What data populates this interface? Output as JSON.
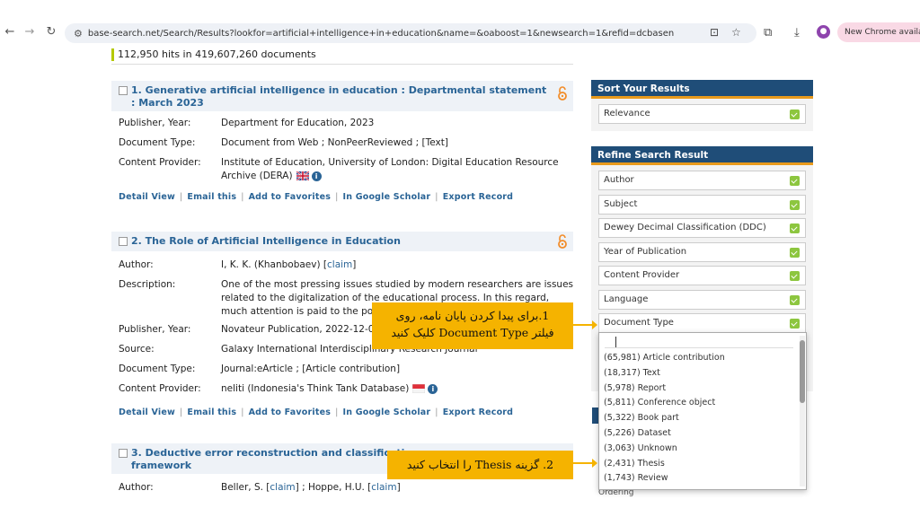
{
  "browser": {
    "url": "base-search.net/Search/Results?lookfor=artificial+intelligence+in+education&name=&oaboost=1&newsearch=1&refid=dcbasen",
    "new_chrome": "New Chrome available"
  },
  "results": {
    "hits": "112,950 hits in 419,607,260 documents",
    "records": [
      {
        "title": "1. Generative artificial intelligence in education : Departmental statement : March 2023",
        "fields": [
          {
            "k": "Publisher, Year:",
            "v": "Department for Education, 2023"
          },
          {
            "k": "Document Type:",
            "v": "Document from Web ; NonPeerReviewed ; [Text]"
          },
          {
            "k": "Content Provider:",
            "v": "Institute of Education, University of London: Digital Education Resource Archive (DERA)"
          }
        ]
      },
      {
        "title": "2. The Role of Artificial Intelligence in Education",
        "fields": [
          {
            "k": "Author:",
            "v": "I, K. K. (Khanbobaev)",
            "claim": "claim"
          },
          {
            "k": "Description:",
            "v": "One of the most pressing issues studied by modern researchers are issues related to the digitalization of the educational process. In this regard, much attention is paid to the pos"
          },
          {
            "k": "Publisher, Year:",
            "v": "Novateur Publication, 2022-12-07"
          },
          {
            "k": "Source:",
            "v": "Galaxy International Interdisciplinary Research Journal"
          },
          {
            "k": "Document Type:",
            "v": "Journal:eArticle ; [Article contribution]"
          },
          {
            "k": "Content Provider:",
            "v": "neliti (Indonesia's Think Tank Database)"
          }
        ]
      },
      {
        "title": "3. Deductive error reconstruction and classification",
        "title_line2": "framework",
        "fields": [
          {
            "k": "Author:",
            "v": "Beller, S.",
            "v2": "; Hoppe, H.U.",
            "claim": "claim"
          }
        ]
      }
    ],
    "actions": [
      "Detail View",
      "Email this",
      "Add to Favorites",
      "In Google Scholar",
      "Export Record"
    ]
  },
  "sidebar": {
    "sort_title": "Sort Your Results",
    "sort_value": "Relevance",
    "refine_title": "Refine Search Result",
    "facets": [
      "Author",
      "Subject",
      "Dewey Decimal Classification (DDC)",
      "Year of Publication",
      "Content Provider",
      "Language",
      "Document Type"
    ],
    "dropdown": [
      "(65,981) Article contribution",
      "(18,317) Text",
      "(5,978) Report",
      "(5,811) Conference object",
      "(5,322) Book part",
      "(5,226) Dataset",
      "(3,063) Unknown",
      "(2,431) Thesis",
      "(1,743) Review"
    ],
    "peek": "Ordering"
  },
  "callouts": {
    "c1_line1": "1.برای پیدا کردن پایان نامه، روی",
    "c1_line2": "فیلتر Document Type کلیک کنید",
    "c2": "2. گزینه  Thesis را انتخاب کنید"
  },
  "colors": {
    "accent": "#f5b300",
    "header": "#1f4d78",
    "link": "#2a6496"
  }
}
